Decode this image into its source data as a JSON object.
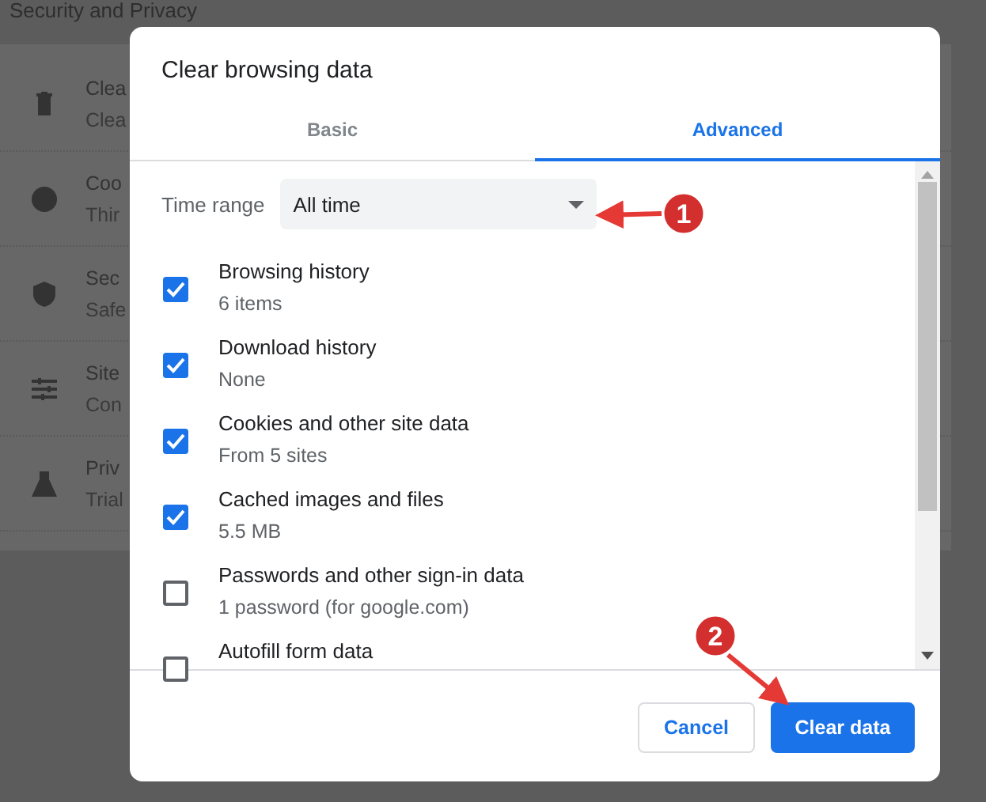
{
  "background_page": {
    "heading": "Security and Privacy",
    "items": [
      {
        "title": "Clea",
        "subtitle": "Clea"
      },
      {
        "title": "Coo",
        "subtitle": "Thir"
      },
      {
        "title": "Sec",
        "subtitle": "Safe"
      },
      {
        "title": "Site",
        "subtitle": "Con"
      },
      {
        "title": "Priv",
        "subtitle": "Trial"
      }
    ]
  },
  "dialog": {
    "title": "Clear browsing data",
    "tabs": [
      {
        "label": "Basic",
        "selected": false
      },
      {
        "label": "Advanced",
        "selected": true
      }
    ],
    "time_range": {
      "label": "Time range",
      "value": "All time"
    },
    "options": [
      {
        "label": "Browsing history",
        "detail": "6 items",
        "checked": true
      },
      {
        "label": "Download history",
        "detail": "None",
        "checked": true
      },
      {
        "label": "Cookies and other site data",
        "detail": "From 5 sites",
        "checked": true
      },
      {
        "label": "Cached images and files",
        "detail": "5.5 MB",
        "checked": true
      },
      {
        "label": "Passwords and other sign-in data",
        "detail": "1 password (for google.com)",
        "checked": false
      },
      {
        "label": "Autofill form data",
        "checked": false
      }
    ],
    "buttons": [
      {
        "label": "Cancel",
        "kind": "secondary"
      },
      {
        "label": "Clear data",
        "kind": "primary"
      }
    ]
  },
  "annotations": [
    {
      "number": "1"
    },
    {
      "number": "2"
    }
  ]
}
